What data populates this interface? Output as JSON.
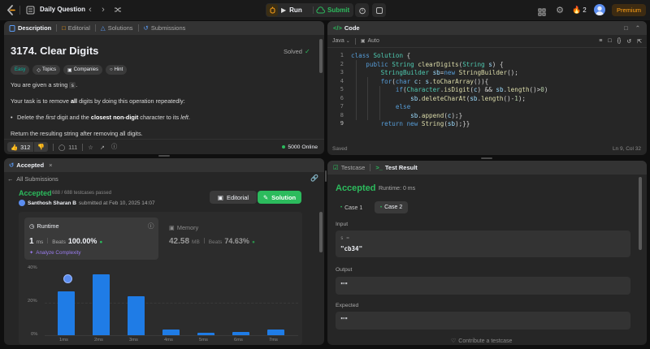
{
  "topbar": {
    "problem_list_label": "Daily Question",
    "run_label": "Run",
    "submit_label": "Submit",
    "streak_count": "2",
    "premium_label": "Premium"
  },
  "description_panel": {
    "tabs": [
      "Description",
      "Editorial",
      "Solutions",
      "Submissions"
    ],
    "title": "3174. Clear Digits",
    "solved_label": "Solved",
    "tags": [
      "Easy",
      "Topics",
      "Companies",
      "Hint"
    ],
    "para1_before": "You are given a string ",
    "para1_code": "s",
    "para1_after": ".",
    "para2_before": "Your task is to remove ",
    "para2_bold": "all",
    "para2_after": " digits by doing this operation repeatedly:",
    "bullet_a": "Delete the ",
    "bullet_b": "first",
    "bullet_c": " digit and the ",
    "bullet_d": "closest non-digit",
    "bullet_e": " character to its ",
    "bullet_f": "left",
    "bullet_g": ".",
    "para3": "Return the resulting string after removing all digits.",
    "likes": "312",
    "comments": "111",
    "online": "5000 Online"
  },
  "code_panel": {
    "title": "Code",
    "language": "Java",
    "mode": "Auto",
    "status": "Saved",
    "cursor": "Ln 9, Col 32",
    "line_numbers": [
      "1",
      "2",
      "3",
      "4",
      "5",
      "6",
      "7",
      "8",
      "9"
    ]
  },
  "accepted_panel": {
    "tab_title": "Accepted",
    "back_label": "All Submissions",
    "verdict": "Accepted",
    "testcases": "688 / 688 testcases passed",
    "user": "Santhosh Sharan B",
    "submitted_text": "submitted at Feb 10, 2025 14:07",
    "editorial_label": "Editorial",
    "solution_label": "Solution",
    "runtime_label": "Runtime",
    "runtime_value": "1",
    "runtime_unit": "ms",
    "beats_label": "Beats",
    "runtime_beats": "100.00%",
    "analyze_label": "Analyze Complexity",
    "memory_label": "Memory",
    "memory_value": "42.58",
    "memory_unit": "MB",
    "memory_beats": "74.63%"
  },
  "chart_data": {
    "type": "bar",
    "categories": [
      "1ms",
      "2ms",
      "3ms",
      "4ms",
      "5ms",
      "6ms",
      "7ms"
    ],
    "values": [
      26,
      36,
      23,
      3.5,
      1.5,
      2,
      3.3
    ],
    "y_ticks": [
      "40%",
      "20%",
      "0%"
    ],
    "ylim": [
      0,
      40
    ],
    "bar_color": "#1f7ce6"
  },
  "testresult_panel": {
    "testcase_tab": "Testcase",
    "result_tab": "Test Result",
    "verdict": "Accepted",
    "runtime": "Runtime: 0 ms",
    "case1": "Case 1",
    "case2": "Case 2",
    "input_label": "Input",
    "input_var": "s =",
    "input_value": "\"cb34\"",
    "output_label": "Output",
    "output_value": "\"\"",
    "expected_label": "Expected",
    "expected_value": "\"\"",
    "contribute": "Contribute a testcase"
  },
  "colors": {
    "accent_green": "#2cbb5d",
    "accent_orange": "#ffa116",
    "easy_teal": "#00b8a3",
    "bar_blue": "#1f7ce6"
  }
}
